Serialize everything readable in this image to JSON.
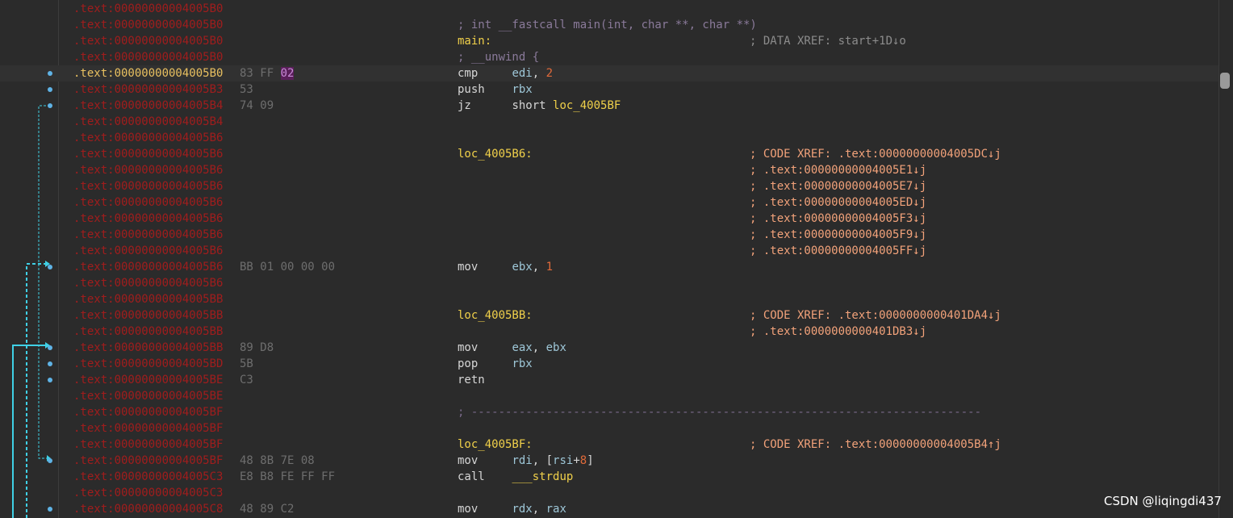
{
  "lines": [
    {
      "addr": ".text:00000000004005B0",
      "bytes": "",
      "ins": "",
      "bp": false
    },
    {
      "addr": ".text:00000000004005B0",
      "bytes": "",
      "ins_comment": "; int __fastcall main(int, char **, char **)",
      "bp": false
    },
    {
      "addr": ".text:00000000004005B0",
      "bytes": "",
      "label": "main:",
      "xref_grey": "; DATA XREF: start+1D↓o",
      "bp": false
    },
    {
      "addr": ".text:00000000004005B0",
      "bytes": "",
      "ins_comment": "; __unwind {",
      "bp": false
    },
    {
      "addr": ".text:00000000004005B0",
      "bytes": "83 FF",
      "bytes_hl": "02",
      "mnem": "cmp",
      "opnds": [
        {
          "t": "reg",
          "v": "edi"
        },
        {
          "t": "op",
          "v": ", "
        },
        {
          "t": "num",
          "v": "2"
        }
      ],
      "bp": true,
      "current": true
    },
    {
      "addr": ".text:00000000004005B3",
      "bytes": "53",
      "mnem": "push",
      "opnds": [
        {
          "t": "reg",
          "v": "rbx"
        }
      ],
      "bp": true
    },
    {
      "addr": ".text:00000000004005B4",
      "bytes": "74 09",
      "mnem": "jz",
      "opnds": [
        {
          "t": "op",
          "v": "short "
        },
        {
          "t": "sym",
          "v": "loc_4005BF"
        }
      ],
      "bp": true
    },
    {
      "addr": ".text:00000000004005B4",
      "bytes": "",
      "bp": false
    },
    {
      "addr": ".text:00000000004005B6",
      "bytes": "",
      "bp": false
    },
    {
      "addr": ".text:00000000004005B6",
      "bytes": "",
      "label": "loc_4005B6:",
      "xref": "; CODE XREF: .text:00000000004005DC↓j",
      "bp": false
    },
    {
      "addr": ".text:00000000004005B6",
      "bytes": "",
      "xref": "; .text:00000000004005E1↓j",
      "bp": false
    },
    {
      "addr": ".text:00000000004005B6",
      "bytes": "",
      "xref": "; .text:00000000004005E7↓j",
      "bp": false
    },
    {
      "addr": ".text:00000000004005B6",
      "bytes": "",
      "xref": "; .text:00000000004005ED↓j",
      "bp": false
    },
    {
      "addr": ".text:00000000004005B6",
      "bytes": "",
      "xref": "; .text:00000000004005F3↓j",
      "bp": false
    },
    {
      "addr": ".text:00000000004005B6",
      "bytes": "",
      "xref": "; .text:00000000004005F9↓j",
      "bp": false
    },
    {
      "addr": ".text:00000000004005B6",
      "bytes": "",
      "xref": "; .text:00000000004005FF↓j",
      "bp": false
    },
    {
      "addr": ".text:00000000004005B6",
      "bytes": "BB 01 00 00 00",
      "mnem": "mov",
      "opnds": [
        {
          "t": "reg",
          "v": "ebx"
        },
        {
          "t": "op",
          "v": ", "
        },
        {
          "t": "num",
          "v": "1"
        }
      ],
      "bp": true
    },
    {
      "addr": ".text:00000000004005B6",
      "bytes": "",
      "bp": false
    },
    {
      "addr": ".text:00000000004005BB",
      "bytes": "",
      "bp": false
    },
    {
      "addr": ".text:00000000004005BB",
      "bytes": "",
      "label": "loc_4005BB:",
      "xref": "; CODE XREF: .text:0000000000401DA4↓j",
      "bp": false
    },
    {
      "addr": ".text:00000000004005BB",
      "bytes": "",
      "xref": "; .text:0000000000401DB3↓j",
      "bp": false
    },
    {
      "addr": ".text:00000000004005BB",
      "bytes": "89 D8",
      "mnem": "mov",
      "opnds": [
        {
          "t": "reg",
          "v": "eax"
        },
        {
          "t": "op",
          "v": ", "
        },
        {
          "t": "reg",
          "v": "ebx"
        }
      ],
      "bp": true
    },
    {
      "addr": ".text:00000000004005BD",
      "bytes": "5B",
      "mnem": "pop",
      "opnds": [
        {
          "t": "reg",
          "v": "rbx"
        }
      ],
      "bp": true
    },
    {
      "addr": ".text:00000000004005BE",
      "bytes": "C3",
      "mnem": "retn",
      "opnds": [],
      "bp": true
    },
    {
      "addr": ".text:00000000004005BE",
      "bytes": "",
      "bp": false
    },
    {
      "addr": ".text:00000000004005BF",
      "bytes": "",
      "separator": "; ---------------------------------------------------------------------------",
      "bp": false
    },
    {
      "addr": ".text:00000000004005BF",
      "bytes": "",
      "bp": false
    },
    {
      "addr": ".text:00000000004005BF",
      "bytes": "",
      "label": "loc_4005BF:",
      "xref": "; CODE XREF: .text:00000000004005B4↑j",
      "bp": false
    },
    {
      "addr": ".text:00000000004005BF",
      "bytes": "48 8B 7E 08",
      "mnem": "mov",
      "opnds": [
        {
          "t": "reg",
          "v": "rdi"
        },
        {
          "t": "op",
          "v": ", ["
        },
        {
          "t": "reg",
          "v": "rsi"
        },
        {
          "t": "op",
          "v": "+"
        },
        {
          "t": "num",
          "v": "8"
        },
        {
          "t": "op",
          "v": "]"
        }
      ],
      "bp": true
    },
    {
      "addr": ".text:00000000004005C3",
      "bytes": "E8 B8 FE FF FF",
      "mnem": "call",
      "opnds": [
        {
          "t": "sym",
          "v": "___strdup"
        }
      ],
      "bp": false
    },
    {
      "addr": ".text:00000000004005C3",
      "bytes": "",
      "bp": false
    },
    {
      "addr": ".text:00000000004005C8",
      "bytes": "48 89 C2",
      "mnem": "mov",
      "opnds": [
        {
          "t": "reg",
          "v": "rdx"
        },
        {
          "t": "op",
          "v": ", "
        },
        {
          "t": "reg",
          "v": "rax"
        }
      ],
      "bp": true
    }
  ],
  "watermark": "CSDN @liqingdi437",
  "colors": {
    "background": "#2b2b2b",
    "address": "#a01d1d",
    "address_current": "#e8c060",
    "label": "#f0d04a",
    "register": "#9ec7d8",
    "number": "#e06a3a",
    "xref": "#f2a27a",
    "arrow": "#3fd0e6"
  }
}
